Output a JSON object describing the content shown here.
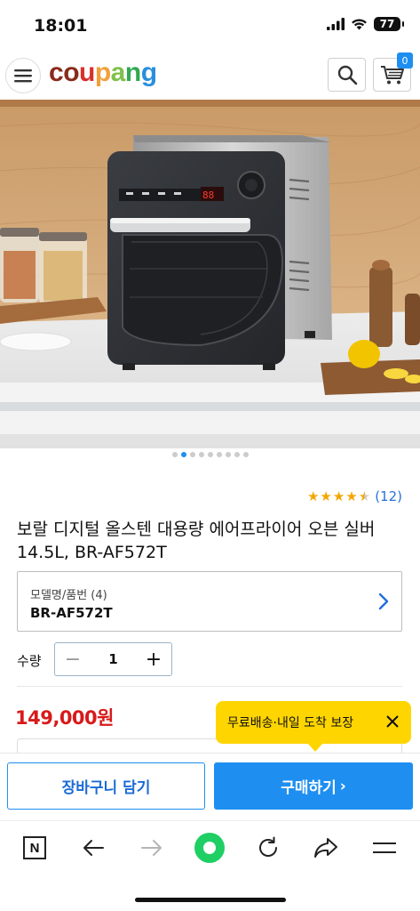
{
  "status_bar": {
    "time": "18:01",
    "battery": "77"
  },
  "header": {
    "logo_letters": [
      {
        "ch": "c",
        "color": "#8a2b1b"
      },
      {
        "ch": "o",
        "color": "#8a2b1b"
      },
      {
        "ch": "u",
        "color": "#d8302c"
      },
      {
        "ch": "p",
        "color": "#f2a03a"
      },
      {
        "ch": "a",
        "color": "#7fc04a"
      },
      {
        "ch": "n",
        "color": "#32a852"
      },
      {
        "ch": "g",
        "color": "#2a8fdc"
      }
    ],
    "cart_count": "0"
  },
  "carousel": {
    "total": 9,
    "active_index": 1
  },
  "rating": {
    "stars": 4.5,
    "count": "(12)"
  },
  "product": {
    "title": "보랄 디지털 올스텐 대용량 에어프라이어 오븐 실버 14.5L, BR-AF572T",
    "model_label": "모델명/품번 (4)",
    "model_value": "BR-AF572T",
    "qty_label": "수량",
    "qty_minus": "−",
    "qty_value": "1",
    "qty_plus": "+",
    "price": "149,000원"
  },
  "tooltip": {
    "text": "무료배송·내일 도착 보장"
  },
  "actions": {
    "cart_label": "장바구니 담기",
    "buy_label": "구매하기",
    "buy_arrow": "›"
  },
  "toolbar": {
    "items": [
      "naver-icon",
      "back-icon",
      "forward-icon",
      "home-icon",
      "refresh-icon",
      "share-icon",
      "menu-icon"
    ],
    "naver_letter": "N"
  },
  "colors": {
    "accent": "#1e8ff0",
    "price": "#d81a1a",
    "tooltip": "#ffd500",
    "star": "#f3a600",
    "home_green": "#1fcf63"
  }
}
